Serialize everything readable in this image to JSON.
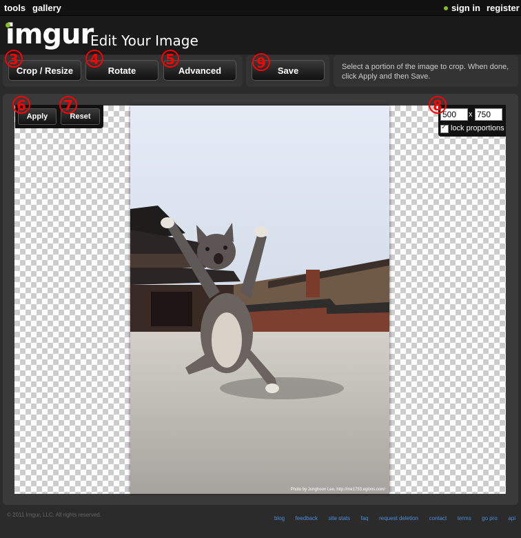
{
  "topbar": {
    "tools": "tools",
    "gallery": "gallery",
    "sign_in": "sign in",
    "register": "register",
    "online_dot_color": "#85bf25"
  },
  "header": {
    "logo": "imgur",
    "title": "Edit Your Image",
    "accent_color": "#85bf25"
  },
  "toolbar": {
    "crop_resize": "Crop / Resize",
    "rotate": "Rotate",
    "advanced": "Advanced",
    "save": "Save",
    "hint": "Select a portion of the image to crop. When done, click Apply and then Save."
  },
  "crop_tools": {
    "apply": "Apply",
    "reset": "Reset"
  },
  "dimensions": {
    "width": "500",
    "x": "x",
    "height": "750",
    "lock_label": "lock proportions",
    "lock_checked": true
  },
  "image": {
    "credit": "Photo by Junghoon Lee, http://me1733.egloos.com/"
  },
  "annotations": {
    "crop_resize": "3",
    "rotate": "4",
    "advanced": "5",
    "apply": "6",
    "reset": "7",
    "dims": "8",
    "save": "9"
  },
  "footer": {
    "copyright": "© 2011 Imgur, LLC. All rights reserved.",
    "links": [
      "blog",
      "feedback",
      "site stats",
      "faq",
      "request deletion",
      "contact",
      "terms",
      "go pro",
      "api"
    ]
  }
}
